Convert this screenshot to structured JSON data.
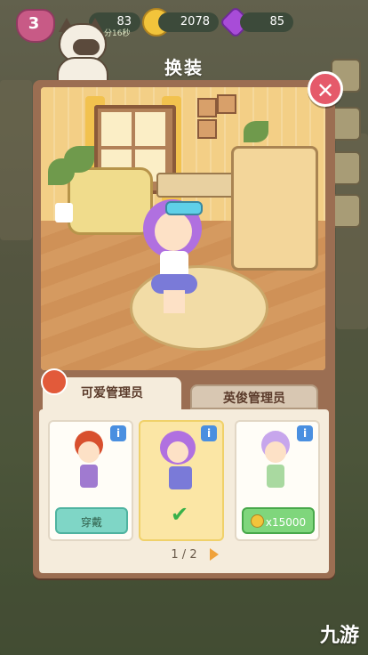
{
  "hud": {
    "level": "3",
    "energy": "83",
    "timer": "分16秒",
    "coins": "2078",
    "gems": "85"
  },
  "dialog": {
    "title": "换装",
    "close_icon": "close-icon"
  },
  "tabs": [
    {
      "label": "可爱管理员",
      "active": true
    },
    {
      "label": "英俊管理员",
      "active": false
    }
  ],
  "outfits": [
    {
      "button": "穿戴",
      "state": "owned",
      "info": "i"
    },
    {
      "button": "",
      "state": "equipped",
      "info": "i"
    },
    {
      "button": "x15000",
      "state": "locked",
      "info": "i"
    }
  ],
  "pager": {
    "text": "1 / 2"
  },
  "watermark": "九游",
  "colors": {
    "panel": "#9b6e52",
    "close": "#e55a6a",
    "info": "#4a8fe0",
    "wear": "#7fd6c6",
    "buy": "#7fd67c",
    "selected_card": "#fbe6a5"
  }
}
